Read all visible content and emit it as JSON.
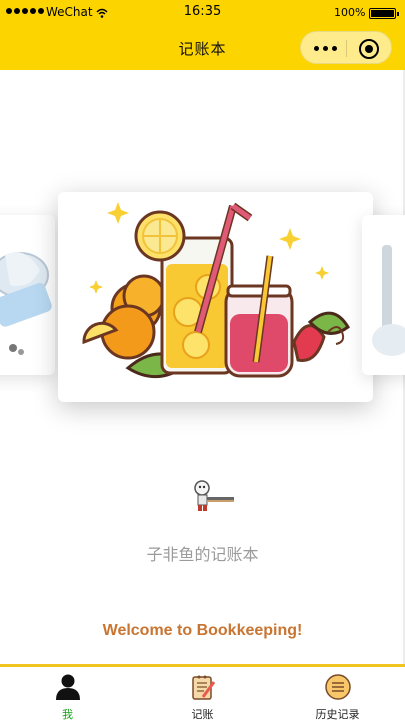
{
  "status_bar": {
    "carrier": "WeChat",
    "time": "16:35",
    "battery": "100%"
  },
  "nav": {
    "title": "记账本"
  },
  "profile": {
    "name": "子非鱼的记账本",
    "welcome": "Welcome to Bookkeeping!"
  },
  "tabs": [
    {
      "label": "我",
      "icon": "person-icon",
      "active": true
    },
    {
      "label": "记账",
      "icon": "notebook-icon",
      "active": false
    },
    {
      "label": "历史记录",
      "icon": "history-icon",
      "active": false
    }
  ],
  "colors": {
    "brand": "#fcd500",
    "welcome": "#c97532",
    "active_tab": "#1aa01a"
  }
}
